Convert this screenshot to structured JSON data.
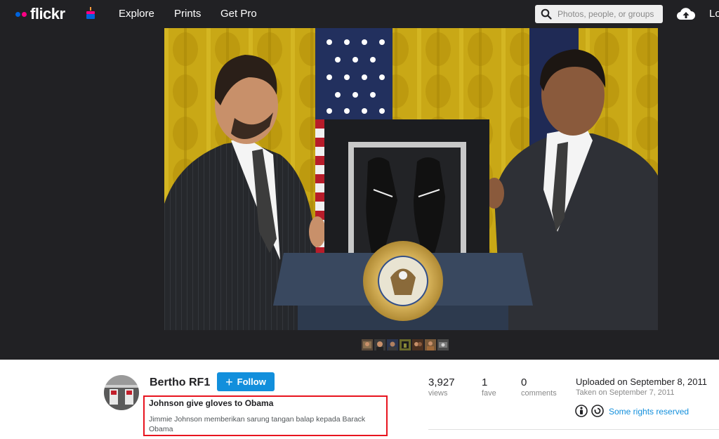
{
  "nav": {
    "logo": "flickr",
    "links": [
      "Explore",
      "Prints",
      "Get Pro"
    ],
    "search_placeholder": "Photos, people, or groups",
    "login": "Log In"
  },
  "photo": {
    "thumbnails": 7
  },
  "owner": {
    "name": "Bertho RF1",
    "follow_label": "Follow"
  },
  "photo_info": {
    "title": "Johnson give gloves to Obama",
    "description": "Jimmie Johnson memberikan sarung tangan balap kepada Barack Obama"
  },
  "stats": [
    {
      "value": "3,927",
      "label": "views"
    },
    {
      "value": "1",
      "label": "fave"
    },
    {
      "value": "0",
      "label": "comments"
    }
  ],
  "dates": {
    "uploaded": "Uploaded on September 8, 2011",
    "taken": "Taken on September 7, 2011"
  },
  "license": {
    "label": "Some rights reserved",
    "icons": [
      "attribution-icon",
      "share-alike-icon"
    ]
  },
  "colors": {
    "brand_blue": "#0063dc",
    "brand_pink": "#ff0084",
    "follow_blue": "#128fdc",
    "highlight_red": "#e8141f",
    "nav_bg": "#212124"
  }
}
